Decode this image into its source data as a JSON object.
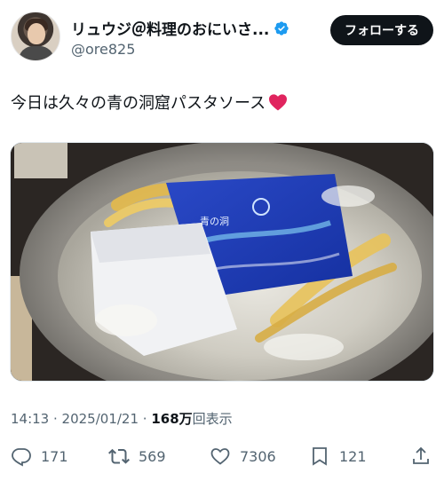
{
  "author": {
    "display_name": "リュウジ＠料理のおにいさ...",
    "handle": "@ore825",
    "verified": true
  },
  "follow_button_label": "フォローする",
  "tweet": {
    "text": "今日は久々の青の洞窟パスタソース",
    "emoji": "red-heart"
  },
  "photo": {
    "package_label": "青の洞"
  },
  "meta": {
    "time": "14:13",
    "separator": " · ",
    "date": "2025/01/21",
    "separator2": " · ",
    "views_count": "168万",
    "views_label": "回表示"
  },
  "actions": {
    "replies": "171",
    "retweets": "569",
    "likes": "7306",
    "bookmarks": "121"
  },
  "colors": {
    "primary_text": "#0f1419",
    "secondary_text": "#536471",
    "verified_blue": "#1d9bf0",
    "follow_bg": "#0f1419",
    "heart_red": "#e0245e"
  }
}
